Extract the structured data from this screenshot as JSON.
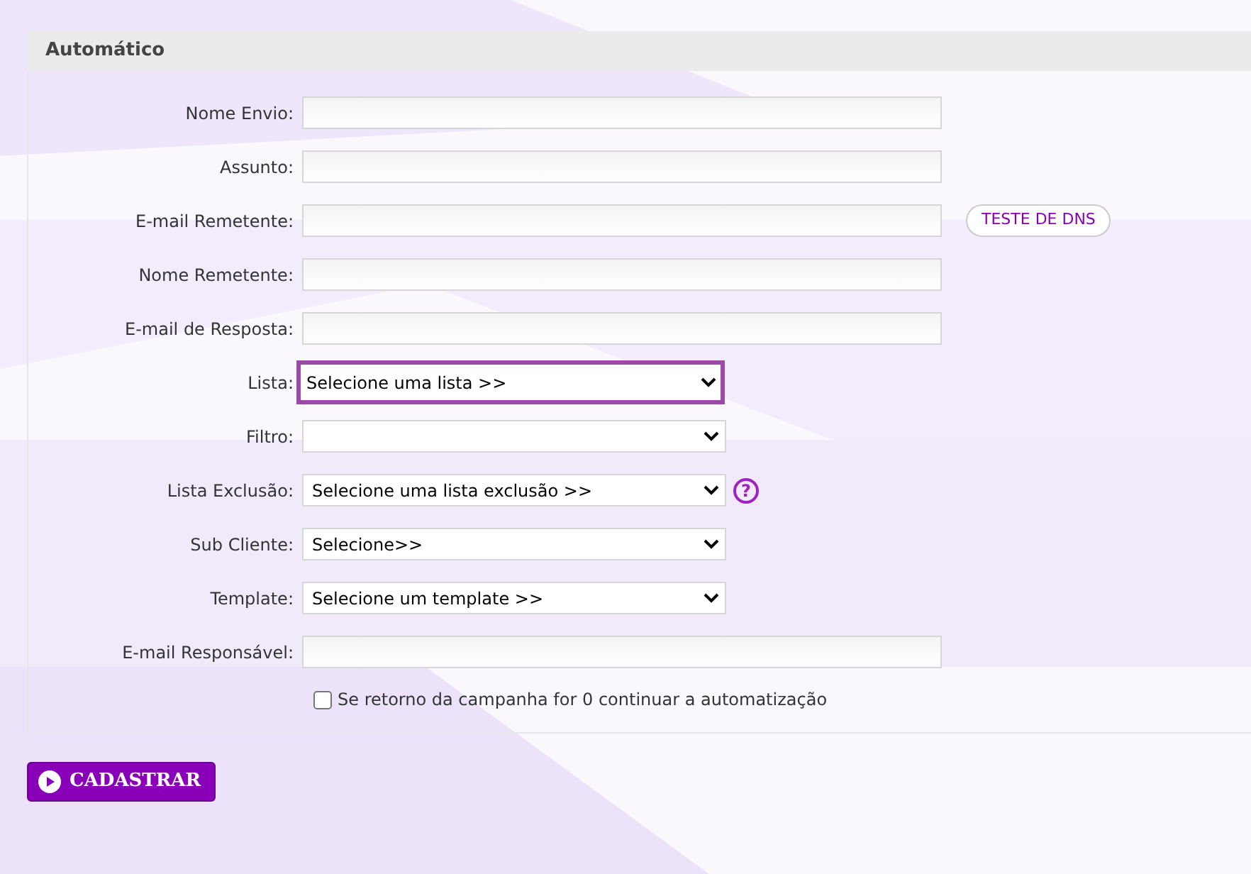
{
  "section": {
    "title": "Automático"
  },
  "fields": [
    {
      "kind": "text",
      "label": "Nome Envio:"
    },
    {
      "kind": "text",
      "label": "Assunto:"
    },
    {
      "kind": "text",
      "label": "E-mail Remetente:",
      "button": "TESTE DE DNS"
    },
    {
      "kind": "text",
      "label": "Nome Remetente:"
    },
    {
      "kind": "text",
      "label": "E-mail de Resposta:"
    },
    {
      "kind": "select",
      "label": "Lista:",
      "value": "Selecione uma lista >>",
      "focused": true
    },
    {
      "kind": "select",
      "label": "Filtro:",
      "focused": false
    },
    {
      "kind": "select",
      "label": "Lista Exclusão:",
      "value": "Selecione uma lista exclusão >>",
      "focused": false,
      "help": "?"
    },
    {
      "kind": "select",
      "label": "Sub Cliente:",
      "value": "Selecione>>",
      "focused": false
    },
    {
      "kind": "select",
      "label": "Template:",
      "value": "Selecione um template >>",
      "focused": false
    },
    {
      "kind": "text",
      "label": "E-mail Responsável:"
    }
  ],
  "checkbox": {
    "label": "Se retorno da campanha for 0 continuar a automatização",
    "checked": false
  },
  "submit": {
    "label": "CADASTRAR"
  }
}
